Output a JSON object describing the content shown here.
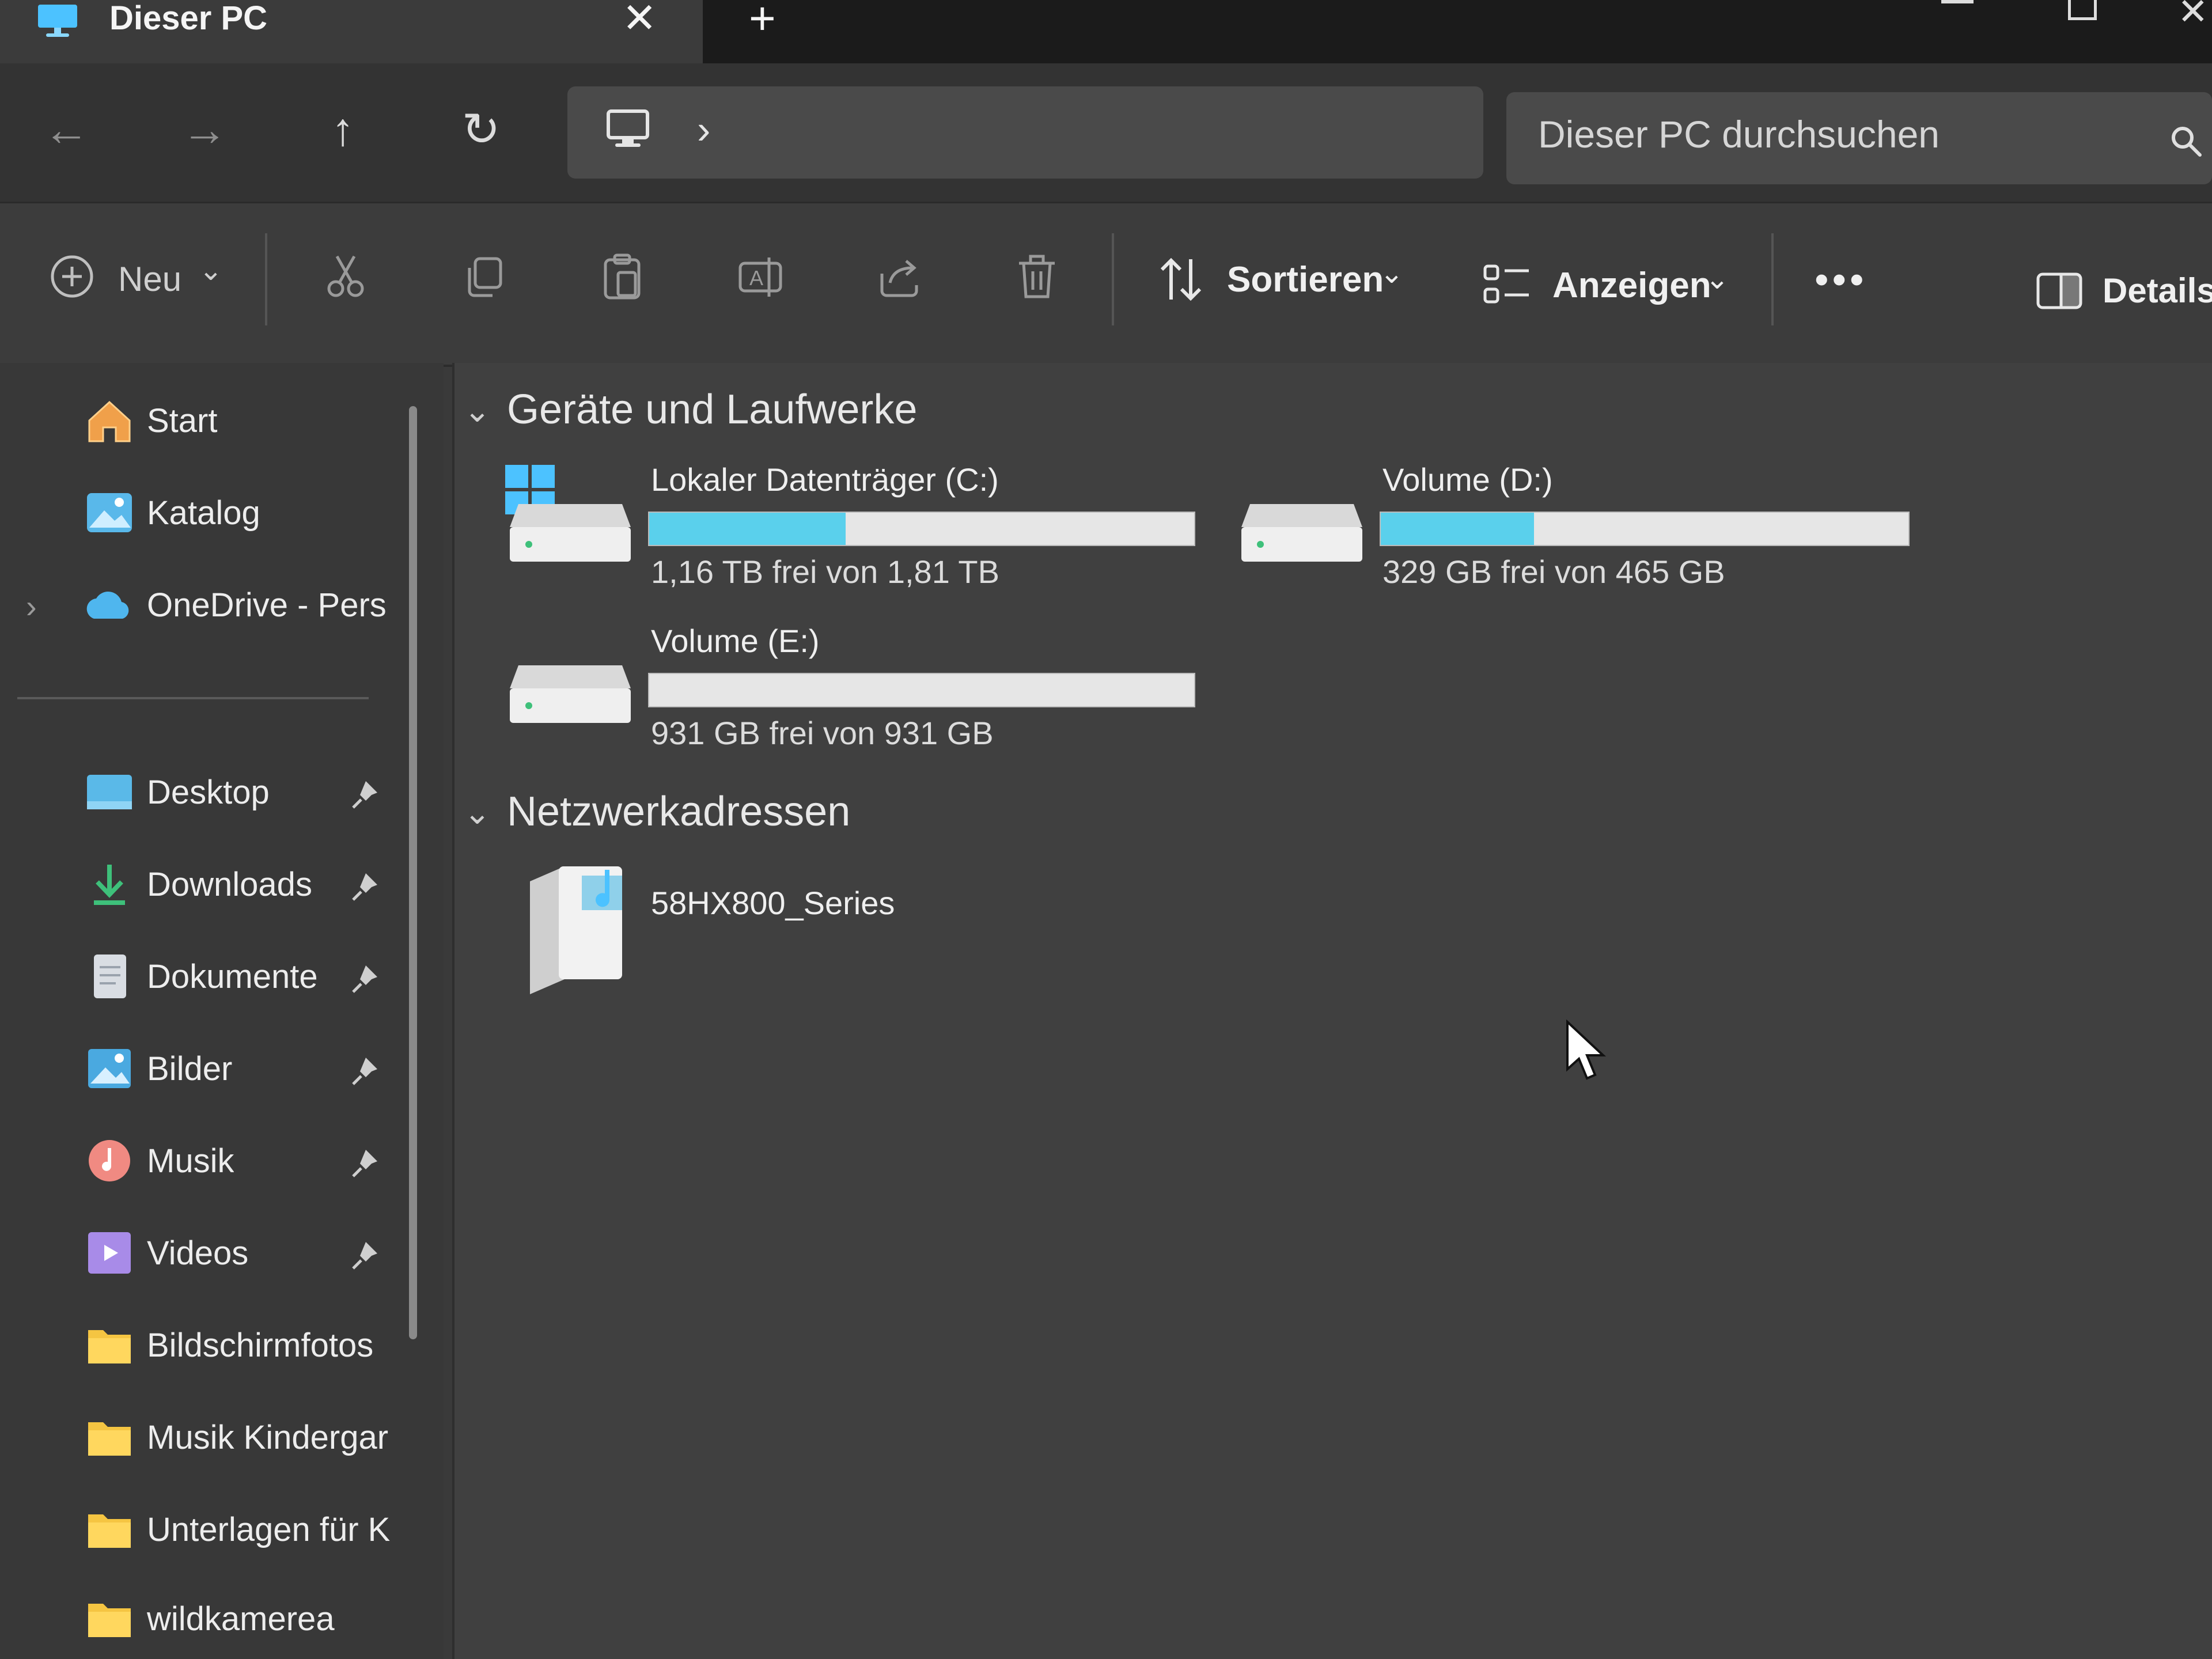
{
  "tab": {
    "title": "Dieser PC",
    "close_glyph": "✕",
    "new_tab_glyph": "+"
  },
  "window": {
    "close_glyph": "✕"
  },
  "nav": {
    "back_glyph": "←",
    "forward_glyph": "→",
    "up_glyph": "↑",
    "refresh_glyph": "↻",
    "breadcrumb_chevron": "›",
    "search_placeholder": "Dieser PC durchsuchen"
  },
  "commands": {
    "new_label": "Neu",
    "chevron": "⌄",
    "sort_label": "Sortieren",
    "view_label": "Anzeigen",
    "more_glyph": "•••",
    "details_label": "Details"
  },
  "sidebar": {
    "expand_glyph": "›",
    "top_items": [
      {
        "label": "Start",
        "icon": "home-icon"
      },
      {
        "label": "Katalog",
        "icon": "gallery-icon"
      },
      {
        "label": "OneDrive - Pers",
        "icon": "onedrive-icon"
      }
    ],
    "quick_access": [
      {
        "label": "Desktop",
        "icon": "desktop-folder-icon",
        "pinned": true
      },
      {
        "label": "Downloads",
        "icon": "download-icon",
        "pinned": true
      },
      {
        "label": "Dokumente",
        "icon": "documents-icon",
        "pinned": true
      },
      {
        "label": "Bilder",
        "icon": "pictures-icon",
        "pinned": true
      },
      {
        "label": "Musik",
        "icon": "music-icon",
        "pinned": true
      },
      {
        "label": "Videos",
        "icon": "videos-icon",
        "pinned": true
      },
      {
        "label": "Bildschirmfotos",
        "icon": "folder-icon",
        "pinned": false
      },
      {
        "label": "Musik Kindergar",
        "icon": "folder-icon",
        "pinned": false
      },
      {
        "label": "Unterlagen für K",
        "icon": "folder-icon",
        "pinned": false
      },
      {
        "label": "wildkamerea",
        "icon": "folder-icon",
        "pinned": false
      }
    ]
  },
  "main": {
    "group_chevron": "⌄",
    "devices_header": "Geräte und Laufwerke",
    "drives": [
      {
        "name": "Lokaler Datenträger (C:)",
        "free_text": "1,16 TB frei von 1,81 TB",
        "used_fraction": 0.36,
        "system": true
      },
      {
        "name": "Volume (D:)",
        "free_text": "329 GB frei von 465 GB",
        "used_fraction": 0.29,
        "system": false
      },
      {
        "name": "Volume (E:)",
        "free_text": "931 GB frei von 931 GB",
        "used_fraction": 0.0,
        "system": false
      }
    ],
    "network_header": "Netzwerkadressen",
    "network_items": [
      {
        "name": "58HX800_Series",
        "icon": "media-server-icon"
      }
    ]
  },
  "colors": {
    "drive_fill": "#5ad0ec",
    "folder": "#f5c542",
    "accent": "#4cc2ff"
  }
}
